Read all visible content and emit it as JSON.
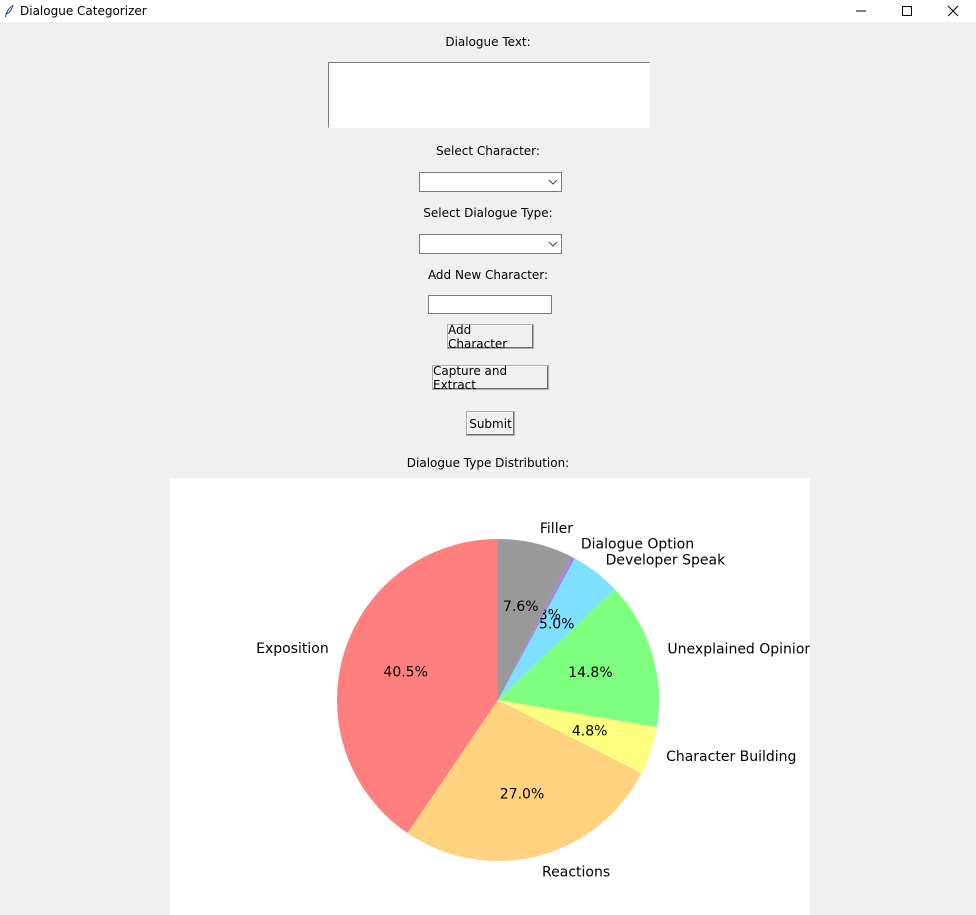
{
  "window": {
    "title": "Dialogue Categorizer"
  },
  "form": {
    "dialogue_text_label": "Dialogue Text:",
    "dialogue_text_value": "",
    "character_label": "Select Character:",
    "character_value": "",
    "dialogue_type_label": "Select Dialogue Type:",
    "dialogue_type_value": "",
    "new_character_label": "Add New Character:",
    "new_character_value": "",
    "add_character_button": "Add Character",
    "capture_button": "Capture and Extract",
    "submit_button": "Submit",
    "distribution_label": "Dialogue Type Distribution:"
  },
  "chart_data": {
    "type": "pie",
    "title": "",
    "startangle_deg": 90,
    "direction": "counterclockwise",
    "slices": [
      {
        "label": "Exposition",
        "value": 40.5,
        "color": "#ff7f7f"
      },
      {
        "label": "Reactions",
        "value": 27.0,
        "color": "#ffd27f"
      },
      {
        "label": "Character Building",
        "value": 4.8,
        "color": "#ffff7f"
      },
      {
        "label": "Unexplained Opinion",
        "value": 14.8,
        "color": "#7fff7f"
      },
      {
        "label": "Developer Speak",
        "value": 5.0,
        "color": "#7fdfff"
      },
      {
        "label": "Dialogue Option",
        "value": 0.3,
        "color": "#9f7fff"
      },
      {
        "label": "Filler",
        "value": 7.6,
        "color": "#999999"
      }
    ]
  }
}
